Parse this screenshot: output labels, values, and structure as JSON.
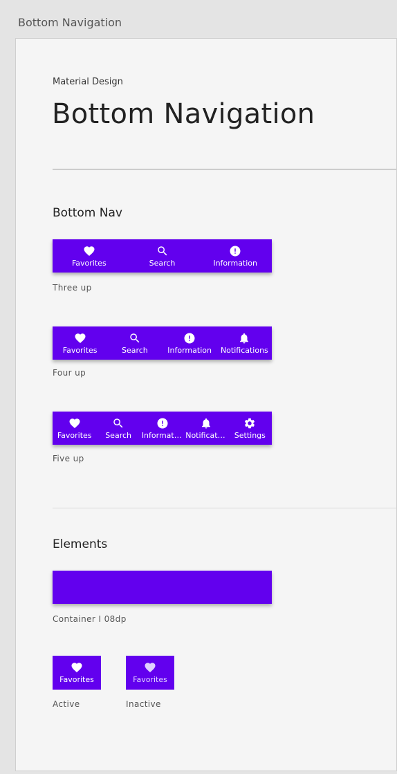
{
  "window": {
    "title": "Bottom Navigation"
  },
  "header": {
    "overline": "Material Design",
    "title": "Bottom Navigation"
  },
  "sections": {
    "bottom_nav": {
      "title": "Bottom Nav"
    },
    "elements": {
      "title": "Elements"
    }
  },
  "three_up": {
    "caption": "Three up",
    "items": [
      {
        "label": "Favorites",
        "icon": "heart-icon"
      },
      {
        "label": "Search",
        "icon": "search-icon"
      },
      {
        "label": "Information",
        "icon": "info-icon"
      }
    ]
  },
  "four_up": {
    "caption": "Four up",
    "items": [
      {
        "label": "Favorites",
        "icon": "heart-icon"
      },
      {
        "label": "Search",
        "icon": "search-icon"
      },
      {
        "label": "Information",
        "icon": "info-icon"
      },
      {
        "label": "Notifications",
        "icon": "bell-icon"
      }
    ]
  },
  "five_up": {
    "caption": "Five up",
    "items": [
      {
        "label": "Favorites",
        "icon": "heart-icon"
      },
      {
        "label": "Search",
        "icon": "search-icon"
      },
      {
        "label": "Information",
        "icon": "info-icon"
      },
      {
        "label": "Notifications",
        "icon": "bell-icon"
      },
      {
        "label": "Settings",
        "icon": "gear-icon"
      }
    ]
  },
  "elements": {
    "container_caption": "Container I 08dp",
    "active": {
      "label": "Favorites",
      "caption": "Active"
    },
    "inactive": {
      "label": "Favorites",
      "caption": "Inactive"
    }
  },
  "colors": {
    "primary": "#6200ee",
    "on_primary": "#ffffff",
    "inactive_tint": "#e0d0ff",
    "background": "#f5f5f5"
  }
}
